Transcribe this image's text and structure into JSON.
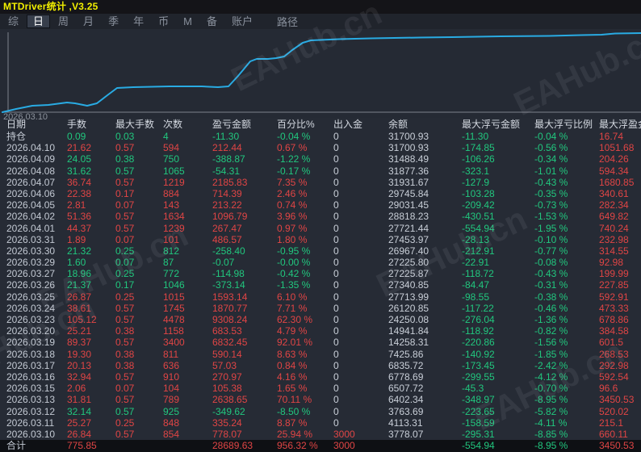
{
  "window": {
    "title": "MTDriver统计 ,V3.25"
  },
  "menu": {
    "tabs": [
      {
        "label": "综",
        "active": false
      },
      {
        "label": "日",
        "active": true
      },
      {
        "label": "周",
        "active": false
      },
      {
        "label": "月",
        "active": false
      },
      {
        "label": "季",
        "active": false
      },
      {
        "label": "年",
        "active": false
      },
      {
        "label": "币",
        "active": false
      },
      {
        "label": "M",
        "active": false
      },
      {
        "label": "备",
        "active": false
      },
      {
        "label": "账户",
        "active": false
      }
    ],
    "path_label": "路径"
  },
  "watermark": {
    "text": "EAHub.cn"
  },
  "chart": {
    "start_label": "2026.03.10",
    "line_color": "#29abe3",
    "polyline": [
      [
        3,
        103
      ],
      [
        20,
        99
      ],
      [
        40,
        95
      ],
      [
        60,
        94
      ],
      [
        83,
        91
      ],
      [
        93,
        92
      ],
      [
        108,
        95
      ],
      [
        120,
        92
      ],
      [
        133,
        82
      ],
      [
        145,
        73
      ],
      [
        165,
        72
      ],
      [
        210,
        71
      ],
      [
        250,
        71
      ],
      [
        270,
        72
      ],
      [
        283,
        71
      ],
      [
        295,
        58
      ],
      [
        310,
        40
      ],
      [
        318,
        37
      ],
      [
        332,
        37
      ],
      [
        342,
        36
      ],
      [
        352,
        34
      ],
      [
        362,
        26
      ],
      [
        375,
        17
      ],
      [
        385,
        14
      ],
      [
        420,
        12.5
      ],
      [
        460,
        11.5
      ],
      [
        520,
        10.5
      ],
      [
        560,
        10
      ],
      [
        620,
        9
      ],
      [
        680,
        8.5
      ],
      [
        700,
        8
      ],
      [
        720,
        7.5
      ],
      [
        745,
        7
      ],
      [
        762,
        5.5
      ],
      [
        794,
        5
      ]
    ]
  },
  "chart_data": {
    "type": "line",
    "title": "",
    "xlabel": "2026.03.10",
    "ylabel": "",
    "legend": [],
    "x": [
      "2026.03.10",
      "2026.03.11",
      "2026.03.12",
      "2026.03.13",
      "2026.03.15",
      "2026.03.16",
      "2026.03.17",
      "2026.03.18",
      "2026.03.19",
      "2026.03.20",
      "2026.03.23",
      "2026.03.24",
      "2026.03.25",
      "2026.03.26",
      "2026.03.27",
      "2026.03.29",
      "2026.03.30",
      "2026.03.31",
      "2026.04.01",
      "2026.04.02",
      "2026.04.05",
      "2026.04.06",
      "2026.04.07",
      "2026.04.08",
      "2026.04.09",
      "2026.04.10"
    ],
    "series": [
      {
        "name": "余额",
        "values": [
          3778.07,
          4113.31,
          3763.69,
          6402.34,
          6507.72,
          6778.69,
          6835.72,
          7425.86,
          14258.31,
          14941.84,
          24250.08,
          26120.85,
          27713.99,
          27340.85,
          27225.87,
          27225.8,
          26967.4,
          27453.97,
          27721.44,
          28818.23,
          29031.45,
          29745.84,
          31931.67,
          31877.36,
          31488.49,
          31700.93
        ]
      }
    ]
  },
  "table": {
    "headers": [
      "日期",
      "手数",
      "最大手数",
      "次数",
      "盈亏金额",
      "百分比%",
      "出入金",
      "余额",
      "最大浮亏金额",
      "最大浮亏比例",
      "最大浮盈金额"
    ],
    "position_row": {
      "date": "持仓",
      "lots": "0.09",
      "max_lots": "0.03",
      "trades": "4",
      "pl": "-11.30",
      "pct": "-0.04 %",
      "in_out": "0",
      "balance": "31700.93",
      "max_float_loss": "-11.30",
      "max_float_loss_pct": "-0.04 %",
      "max_float_profit": "16.74",
      "trend": "down"
    },
    "rows": [
      {
        "date": "2026.04.10",
        "lots": "21.62",
        "max_lots": "0.57",
        "trades": "594",
        "pl": "212.44",
        "pct": "0.67 %",
        "in_out": "0",
        "balance": "31700.93",
        "max_float_loss": "-174.85",
        "max_float_loss_pct": "-0.56 %",
        "max_float_profit": "1051.68",
        "trend": "up"
      },
      {
        "date": "2026.04.09",
        "lots": "24.05",
        "max_lots": "0.38",
        "trades": "750",
        "pl": "-388.87",
        "pct": "-1.22 %",
        "in_out": "0",
        "balance": "31488.49",
        "max_float_loss": "-106.26",
        "max_float_loss_pct": "-0.34 %",
        "max_float_profit": "204.26",
        "trend": "down"
      },
      {
        "date": "2026.04.08",
        "lots": "31.62",
        "max_lots": "0.57",
        "trades": "1065",
        "pl": "-54.31",
        "pct": "-0.17 %",
        "in_out": "0",
        "balance": "31877.36",
        "max_float_loss": "-323.1",
        "max_float_loss_pct": "-1.01 %",
        "max_float_profit": "594.34",
        "trend": "down"
      },
      {
        "date": "2026.04.07",
        "lots": "36.74",
        "max_lots": "0.57",
        "trades": "1219",
        "pl": "2185.83",
        "pct": "7.35 %",
        "in_out": "0",
        "balance": "31931.67",
        "max_float_loss": "-127.9",
        "max_float_loss_pct": "-0.43 %",
        "max_float_profit": "1680.85",
        "trend": "up"
      },
      {
        "date": "2026.04.06",
        "lots": "22.38",
        "max_lots": "0.17",
        "trades": "884",
        "pl": "714.39",
        "pct": "2.46 %",
        "in_out": "0",
        "balance": "29745.84",
        "max_float_loss": "-103.28",
        "max_float_loss_pct": "-0.35 %",
        "max_float_profit": "340.61",
        "trend": "up"
      },
      {
        "date": "2026.04.05",
        "lots": "2.81",
        "max_lots": "0.07",
        "trades": "143",
        "pl": "213.22",
        "pct": "0.74 %",
        "in_out": "0",
        "balance": "29031.45",
        "max_float_loss": "-209.42",
        "max_float_loss_pct": "-0.73 %",
        "max_float_profit": "282.34",
        "trend": "up"
      },
      {
        "date": "2026.04.02",
        "lots": "51.36",
        "max_lots": "0.57",
        "trades": "1634",
        "pl": "1096.79",
        "pct": "3.96 %",
        "in_out": "0",
        "balance": "28818.23",
        "max_float_loss": "-430.51",
        "max_float_loss_pct": "-1.53 %",
        "max_float_profit": "649.82",
        "trend": "up"
      },
      {
        "date": "2026.04.01",
        "lots": "44.37",
        "max_lots": "0.57",
        "trades": "1239",
        "pl": "267.47",
        "pct": "0.97 %",
        "in_out": "0",
        "balance": "27721.44",
        "max_float_loss": "-554.94",
        "max_float_loss_pct": "-1.95 %",
        "max_float_profit": "740.24",
        "trend": "up"
      },
      {
        "date": "2026.03.31",
        "lots": "1.89",
        "max_lots": "0.07",
        "trades": "101",
        "pl": "486.57",
        "pct": "1.80 %",
        "in_out": "0",
        "balance": "27453.97",
        "max_float_loss": "-28.13",
        "max_float_loss_pct": "-0.10 %",
        "max_float_profit": "232.98",
        "trend": "up"
      },
      {
        "date": "2026.03.30",
        "lots": "21.32",
        "max_lots": "0.25",
        "trades": "812",
        "pl": "-258.40",
        "pct": "-0.95 %",
        "in_out": "0",
        "balance": "26967.40",
        "max_float_loss": "-212.91",
        "max_float_loss_pct": "-0.77 %",
        "max_float_profit": "314.55",
        "trend": "down"
      },
      {
        "date": "2026.03.29",
        "lots": "1.60",
        "max_lots": "0.07",
        "trades": "87",
        "pl": "-0.07",
        "pct": "-0.00 %",
        "in_out": "0",
        "balance": "27225.80",
        "max_float_loss": "-22.91",
        "max_float_loss_pct": "-0.08 %",
        "max_float_profit": "92.98",
        "trend": "down"
      },
      {
        "date": "2026.03.27",
        "lots": "18.96",
        "max_lots": "0.25",
        "trades": "772",
        "pl": "-114.98",
        "pct": "-0.42 %",
        "in_out": "0",
        "balance": "27225.87",
        "max_float_loss": "-118.72",
        "max_float_loss_pct": "-0.43 %",
        "max_float_profit": "199.99",
        "trend": "down"
      },
      {
        "date": "2026.03.26",
        "lots": "21.37",
        "max_lots": "0.17",
        "trades": "1046",
        "pl": "-373.14",
        "pct": "-1.35 %",
        "in_out": "0",
        "balance": "27340.85",
        "max_float_loss": "-84.47",
        "max_float_loss_pct": "-0.31 %",
        "max_float_profit": "227.85",
        "trend": "down"
      },
      {
        "date": "2026.03.25",
        "lots": "26.87",
        "max_lots": "0.25",
        "trades": "1015",
        "pl": "1593.14",
        "pct": "6.10 %",
        "in_out": "0",
        "balance": "27713.99",
        "max_float_loss": "-98.55",
        "max_float_loss_pct": "-0.38 %",
        "max_float_profit": "592.91",
        "trend": "up"
      },
      {
        "date": "2026.03.24",
        "lots": "38.61",
        "max_lots": "0.57",
        "trades": "1745",
        "pl": "1870.77",
        "pct": "7.71 %",
        "in_out": "0",
        "balance": "26120.85",
        "max_float_loss": "-117.22",
        "max_float_loss_pct": "-0.46 %",
        "max_float_profit": "473.33",
        "trend": "up"
      },
      {
        "date": "2026.03.23",
        "lots": "105.12",
        "max_lots": "0.57",
        "trades": "4478",
        "pl": "9308.24",
        "pct": "62.30 %",
        "in_out": "0",
        "balance": "24250.08",
        "max_float_loss": "-276.04",
        "max_float_loss_pct": "-1.36 %",
        "max_float_profit": "678.86",
        "trend": "up"
      },
      {
        "date": "2026.03.20",
        "lots": "25.21",
        "max_lots": "0.38",
        "trades": "1158",
        "pl": "683.53",
        "pct": "4.79 %",
        "in_out": "0",
        "balance": "14941.84",
        "max_float_loss": "-118.92",
        "max_float_loss_pct": "-0.82 %",
        "max_float_profit": "384.58",
        "trend": "up"
      },
      {
        "date": "2026.03.19",
        "lots": "89.37",
        "max_lots": "0.57",
        "trades": "3400",
        "pl": "6832.45",
        "pct": "92.01 %",
        "in_out": "0",
        "balance": "14258.31",
        "max_float_loss": "-220.86",
        "max_float_loss_pct": "-1.56 %",
        "max_float_profit": "601.5",
        "trend": "up"
      },
      {
        "date": "2026.03.18",
        "lots": "19.30",
        "max_lots": "0.38",
        "trades": "811",
        "pl": "590.14",
        "pct": "8.63 %",
        "in_out": "0",
        "balance": "7425.86",
        "max_float_loss": "-140.92",
        "max_float_loss_pct": "-1.85 %",
        "max_float_profit": "268.53",
        "trend": "up"
      },
      {
        "date": "2026.03.17",
        "lots": "20.13",
        "max_lots": "0.38",
        "trades": "636",
        "pl": "57.03",
        "pct": "0.84 %",
        "in_out": "0",
        "balance": "6835.72",
        "max_float_loss": "-173.45",
        "max_float_loss_pct": "-2.42 %",
        "max_float_profit": "292.98",
        "trend": "up"
      },
      {
        "date": "2026.03.16",
        "lots": "32.94",
        "max_lots": "0.57",
        "trades": "910",
        "pl": "270.97",
        "pct": "4.16 %",
        "in_out": "0",
        "balance": "6778.69",
        "max_float_loss": "-299.55",
        "max_float_loss_pct": "-4.12 %",
        "max_float_profit": "592.54",
        "trend": "up"
      },
      {
        "date": "2026.03.15",
        "lots": "2.06",
        "max_lots": "0.07",
        "trades": "104",
        "pl": "105.38",
        "pct": "1.65 %",
        "in_out": "0",
        "balance": "6507.72",
        "max_float_loss": "-45.3",
        "max_float_loss_pct": "-0.70 %",
        "max_float_profit": "96.6",
        "trend": "up"
      },
      {
        "date": "2026.03.13",
        "lots": "31.81",
        "max_lots": "0.57",
        "trades": "789",
        "pl": "2638.65",
        "pct": "70.11 %",
        "in_out": "0",
        "balance": "6402.34",
        "max_float_loss": "-348.97",
        "max_float_loss_pct": "-8.95 %",
        "max_float_profit": "3450.53",
        "trend": "up"
      },
      {
        "date": "2026.03.12",
        "lots": "32.14",
        "max_lots": "0.57",
        "trades": "925",
        "pl": "-349.62",
        "pct": "-8.50 %",
        "in_out": "0",
        "balance": "3763.69",
        "max_float_loss": "-223.65",
        "max_float_loss_pct": "-5.82 %",
        "max_float_profit": "520.02",
        "trend": "down"
      },
      {
        "date": "2026.03.11",
        "lots": "25.27",
        "max_lots": "0.25",
        "trades": "848",
        "pl": "335.24",
        "pct": "8.87 %",
        "in_out": "0",
        "balance": "4113.31",
        "max_float_loss": "-158.59",
        "max_float_loss_pct": "-4.11 %",
        "max_float_profit": "215.1",
        "trend": "up"
      },
      {
        "date": "2026.03.10",
        "lots": "26.84",
        "max_lots": "0.57",
        "trades": "854",
        "pl": "778.07",
        "pct": "25.94 %",
        "in_out": "3000",
        "balance": "3778.07",
        "max_float_loss": "-295.31",
        "max_float_loss_pct": "-8.85 %",
        "max_float_profit": "660.11",
        "trend": "up"
      }
    ],
    "total_row": {
      "date": "合计",
      "lots": "775.85",
      "max_lots": "",
      "trades": "",
      "pl": "28689.63",
      "pct": "956.32 %",
      "in_out": "3000",
      "balance": "",
      "max_float_loss": "-554.94",
      "max_float_loss_pct": "-8.95 %",
      "max_float_profit": "3450.53",
      "trend": "up"
    }
  }
}
